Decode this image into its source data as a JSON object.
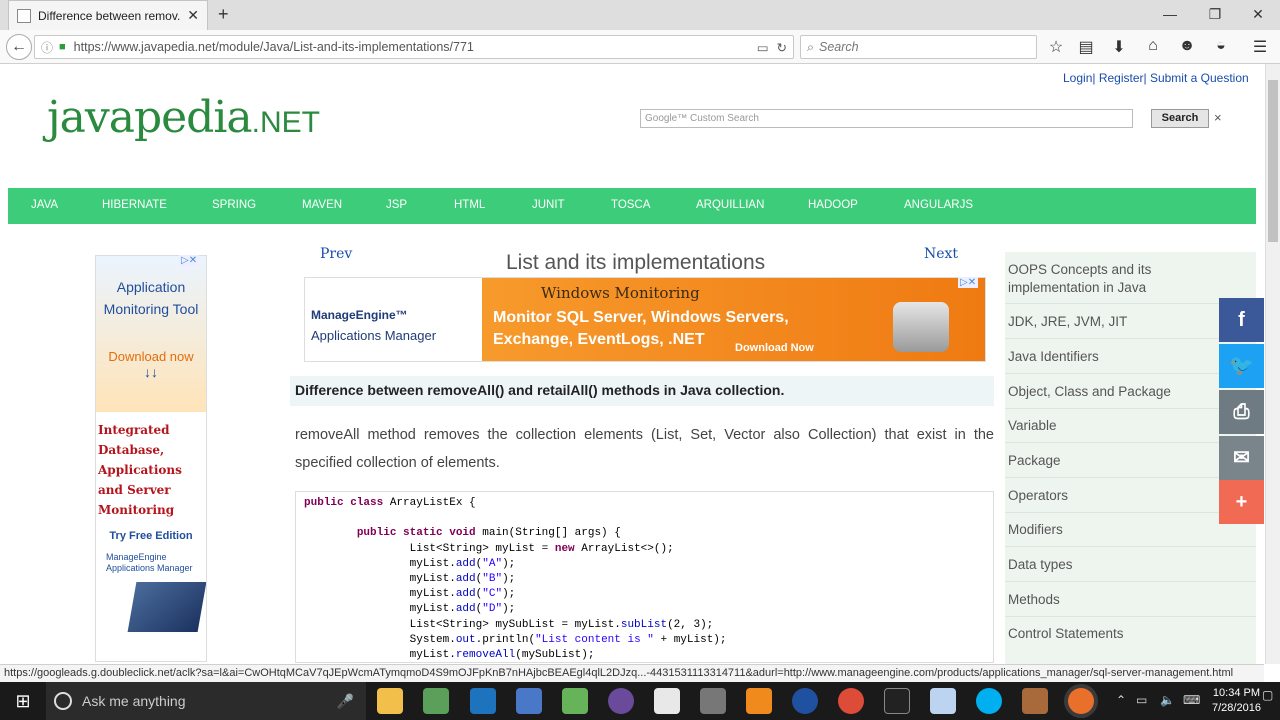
{
  "browser": {
    "tab_title": "Difference between remov...",
    "new_tab": "+",
    "url": "https://www.javapedia.net/module/Java/List-and-its-implementations/771",
    "search_placeholder": "Search",
    "status_url": "https://googleads.g.doubleclick.net/aclk?sa=l&ai=CwOHtqMCaV7qJEpWcmATymqmoD4S9mOJFpKnB7nHAjbcBEAEgl4qlL2DJzq...-4431531113314711&adurl=http://www.manageengine.com/products/applications_manager/sql-server-management.html"
  },
  "header": {
    "top_links": "Login| Register| Submit a Question",
    "logo_main": "javapedia",
    "logo_suffix": ".NET",
    "search_placeholder": "Google™ Custom Search",
    "search_button": "Search",
    "search_close": "×"
  },
  "menu": [
    "JAVA",
    "HIBERNATE",
    "SPRING",
    "MAVEN",
    "JSP",
    "HTML",
    "JUNIT",
    "TOSCA",
    "ARQUILLIAN",
    "HADOOP",
    "ANGULARJS"
  ],
  "left_ad": {
    "line1": "Application",
    "line2": "Monitoring Tool",
    "download": "Download now",
    "arrows": "↓↓",
    "red_text": "Integrated Database, Applications and Server Monitoring",
    "try_free": "Try Free Edition",
    "brand": "ManageEngine Applications Manager"
  },
  "article": {
    "prev": "Prev",
    "next": "Next",
    "title": "List and its implementations",
    "banner": {
      "brand_line1": "ManageEngine™",
      "brand_line2": "Applications Manager",
      "heading": "Windows Monitoring",
      "line1": "Monitor SQL Server, Windows Servers,",
      "line2": "Exchange, EventLogs, .NET",
      "cta": "Download Now"
    },
    "question": "Difference between removeAll() and retailAll() methods in Java collection.",
    "paragraph": "removeAll method removes the collection elements (List, Set, Vector also Collection) that exist in the specified collection of elements."
  },
  "sidebar": [
    "OOPS Concepts and its implementation in Java",
    "JDK, JRE, JVM, JIT",
    "Java Identifiers",
    "Object, Class and Package",
    "Variable",
    "Package",
    "Operators",
    "Modifiers",
    "Data types",
    "Methods",
    "Control Statements"
  ],
  "share": {
    "facebook": "f",
    "twitter": "🐦",
    "print": "⎙",
    "email": "✉",
    "more": "+"
  },
  "taskbar": {
    "cortana": "Ask me anything",
    "time": "10:34 PM",
    "date": "7/28/2016"
  },
  "colors": {
    "menu_green": "#3dcd7a",
    "logo_green": "#2a8a3e",
    "link_blue": "#1a4dab",
    "facebook": "#3b5998",
    "twitter": "#1da1f2",
    "print": "#6f7b83",
    "email": "#7a848b",
    "more": "#f16a54"
  }
}
